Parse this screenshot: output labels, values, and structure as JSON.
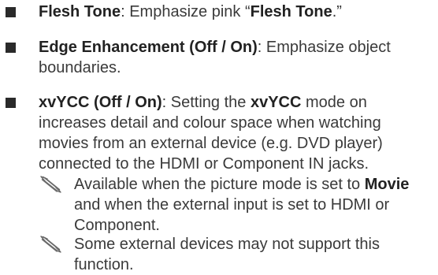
{
  "items": [
    {
      "term": "Flesh Tone",
      "desc_pre": ": Emphasize pink “",
      "desc_bold": "Flesh Tone",
      "desc_post": ".”"
    },
    {
      "term": "Edge Enhancement (Off / On)",
      "desc_pre": ": Emphasize object boundaries."
    },
    {
      "term": "xvYCC (Off / On)",
      "desc_pre": ": Setting the ",
      "desc_bold": "xvYCC",
      "desc_post": " mode on increases detail and colour space when watching movies from an external device (e.g. DVD player) connected to the HDMI or Component IN jacks."
    }
  ],
  "notes": [
    {
      "icon": "note-pencil-icon",
      "pre": "Available when the picture mode is set to ",
      "bold": "Movie",
      "post": " and when the external input is set to HDMI or Component."
    },
    {
      "icon": "note-pencil-icon",
      "pre": "Some external devices may not support this function."
    }
  ]
}
